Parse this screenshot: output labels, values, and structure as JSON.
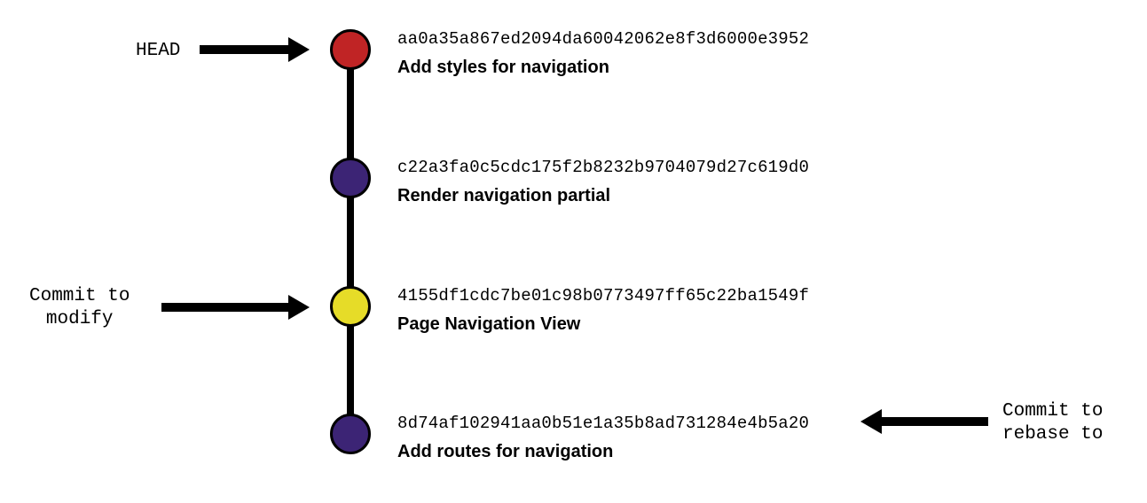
{
  "labels": {
    "head": "HEAD",
    "commit_to_modify": "Commit to\nmodify",
    "commit_to_rebase_to": "Commit to\nrebase to"
  },
  "commits": [
    {
      "hash": "aa0a35a867ed2094da60042062e8f3d6000e3952",
      "message": "Add styles for navigation",
      "color": "red",
      "role": "head"
    },
    {
      "hash": "c22a3fa0c5cdc175f2b8232b9704079d27c619d0",
      "message": "Render navigation partial",
      "color": "purple",
      "role": "normal"
    },
    {
      "hash": "4155df1cdc7be01c98b0773497ff65c22ba1549f",
      "message": "Page Navigation View",
      "color": "yellow",
      "role": "commit_to_modify"
    },
    {
      "hash": "8d74af102941aa0b51e1a35b8ad731284e4b5a20",
      "message": "Add routes for navigation",
      "color": "purple",
      "role": "commit_to_rebase_to"
    }
  ]
}
